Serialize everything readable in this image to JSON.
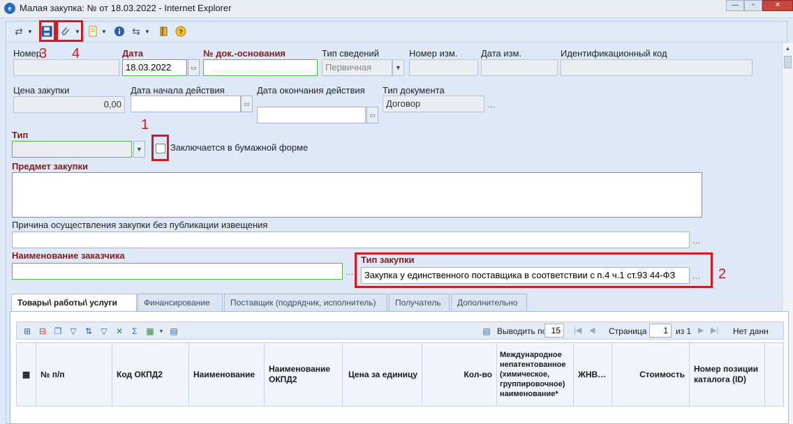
{
  "window": {
    "title": "Малая закупка: № от 18.03.2022 - Internet Explorer",
    "app_icon": "e",
    "minimize": "—",
    "maximize": "▫",
    "close": "✕"
  },
  "toolbar_icons": [
    "actions-icon",
    "save-icon",
    "attach-icon",
    "print-icon",
    "info-icon",
    "refresh-icon",
    "book-icon",
    "help-icon"
  ],
  "fields": {
    "number": {
      "label": "Номер",
      "value": ""
    },
    "date": {
      "label": "Дата",
      "value": "18.03.2022"
    },
    "basis_doc_number": {
      "label": "№ док.-основания",
      "value": ""
    },
    "info_type": {
      "label": "Тип сведений",
      "value": "Первичная"
    },
    "change_number": {
      "label": "Номер изм.",
      "value": ""
    },
    "change_date": {
      "label": "Дата изм.",
      "value": ""
    },
    "id_code": {
      "label": "Идентификационный код",
      "value": ""
    },
    "price": {
      "label": "Цена закупки",
      "value": "0,00"
    },
    "start_date": {
      "label": "Дата начала действия",
      "value": ""
    },
    "end_date": {
      "label": "Дата окончания действия",
      "value": ""
    },
    "doc_type": {
      "label": "Тип документа",
      "value": "Договор"
    },
    "type": {
      "label": "Тип",
      "value": ""
    },
    "paper_form": {
      "label": "Заключается в бумажной форме",
      "checked": false
    },
    "subject": {
      "label": "Предмет закупки",
      "value": ""
    },
    "no_publication_reason": {
      "label": "Причина осуществления закупки без публикации извещения",
      "value": ""
    },
    "customer_name": {
      "label": "Наименование заказчика",
      "value": ""
    },
    "purchase_type": {
      "label": "Тип закупки",
      "value": "Закупка у единственного поставщика в соответствии с п.4 ч.1 ст.93 44-ФЗ"
    }
  },
  "annotations": [
    "1",
    "2",
    "3",
    "4"
  ],
  "tabs": [
    {
      "label": "Товары\\ работы\\ услуги",
      "active": true
    },
    {
      "label": "Финансирование",
      "active": false
    },
    {
      "label": "Поставщик (подрядчик, исполнитель)",
      "active": false
    },
    {
      "label": "Получатель",
      "active": false
    },
    {
      "label": "Дополнительно",
      "active": false
    }
  ],
  "pager": {
    "show_per_label": "Выводить по",
    "per_page": "15",
    "page_label": "Страница",
    "page": "1",
    "of_label": "из 1",
    "no_data": "Нет данн"
  },
  "grid_columns": [
    "№ п/п",
    "Код ОКПД2",
    "Наименование",
    "Наименование ОКПД2",
    "Цена за единицу",
    "Кол-во",
    "Международное непатентованное (химическое, группировочное) наименование*",
    "ЖНВ…",
    "Стоимость",
    "Номер позиции каталога (ID)"
  ],
  "colors": {
    "accent": "#d11a22",
    "required": "#7a1d1d",
    "valid_border": "#54b548",
    "panel": "#dfe8f6"
  }
}
